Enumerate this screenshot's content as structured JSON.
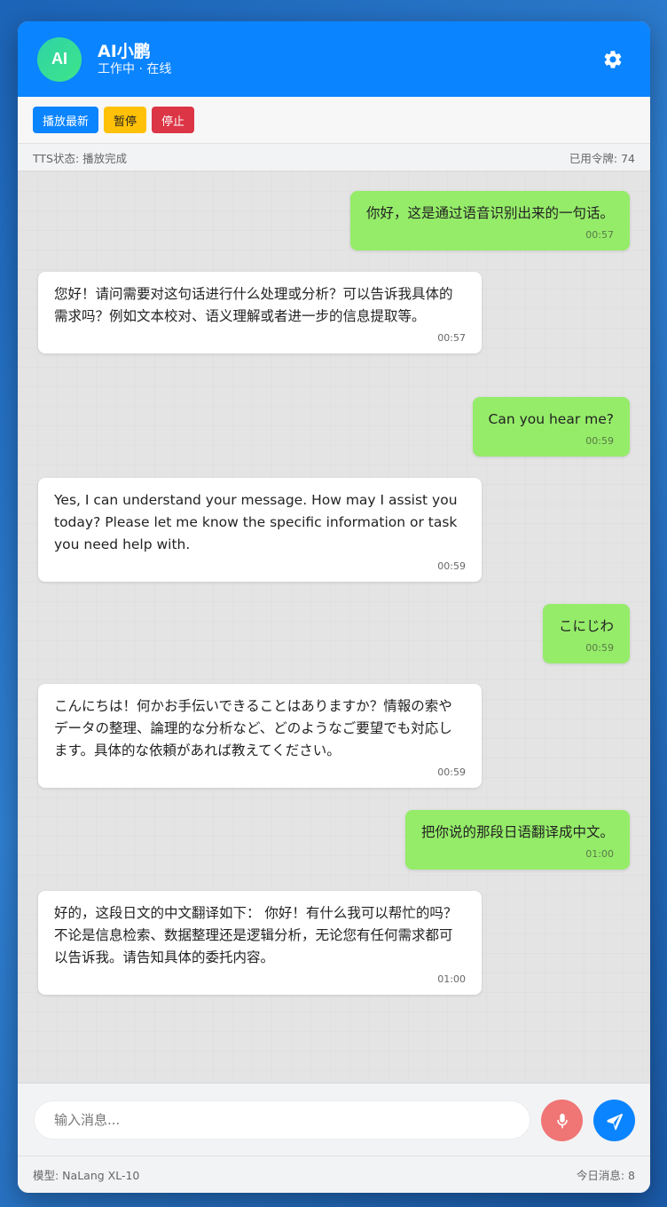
{
  "header": {
    "avatar_text": "AI",
    "bot_name": "AI小鹏",
    "bot_status": "工作中 · 在线",
    "settings_icon": "gear-icon"
  },
  "toolbar": {
    "play_label": "播放最新",
    "pause_label": "暂停",
    "stop_label": "停止"
  },
  "status": {
    "tts": "TTS状态: 播放完成",
    "tokens": "已用令牌: 74"
  },
  "messages": [
    {
      "role": "user",
      "text": "你好，这是通过语音识别出来的一句话。",
      "time": "00:57"
    },
    {
      "role": "bot",
      "text": "您好！请问需要对这句话进行什么处理或分析？可以告诉我具体的需求吗？例如文本校对、语义理解或者进一步的信息提取等。",
      "time": "00:57"
    },
    {
      "role": "user",
      "text": "Can you hear me?",
      "time": "00:59"
    },
    {
      "role": "bot",
      "text": "Yes, I can understand your message. How may I assist you today? Please let me know the specific information or task you need help with.",
      "time": "00:59"
    },
    {
      "role": "user",
      "text": "こにじわ",
      "time": "00:59"
    },
    {
      "role": "bot",
      "text": "こんにちは！何かお手伝いできることはありますか？情報の索やデータの整理、論理的な分析など、どのようなご要望でも対応します。具体的な依頼があれば教えてください。",
      "time": "00:59"
    },
    {
      "role": "user",
      "text": "把你说的那段日语翻译成中文。",
      "time": "01:00"
    },
    {
      "role": "bot",
      "text": "好的，这段日文的中文翻译如下： 你好！有什么我可以帮忙的吗？不论是信息检索、数据整理还是逻辑分析，无论您有任何需求都可以告诉我。请告知具体的委托内容。",
      "time": "01:00"
    }
  ],
  "input": {
    "placeholder": "输入消息...",
    "value": ""
  },
  "footer": {
    "model": "模型: NaLang XL-10",
    "today": "今日消息: 8"
  },
  "colors": {
    "accent": "#0a84ff",
    "user_bubble": "#95ec69",
    "bot_bubble": "#ffffff",
    "pause": "#ffc107",
    "stop": "#dc3545",
    "mic": "#f07575"
  }
}
